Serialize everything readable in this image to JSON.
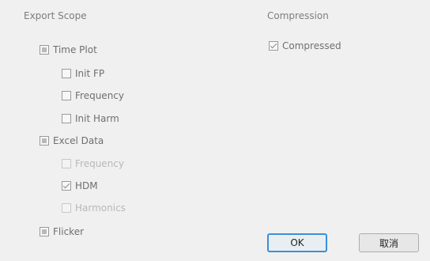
{
  "export_scope": {
    "title": "Export Scope",
    "items": [
      {
        "label": "Time Plot",
        "state": "indeterminate",
        "disabled": false
      },
      {
        "label": "Init FP",
        "state": "unchecked",
        "disabled": false
      },
      {
        "label": "Frequency",
        "state": "unchecked",
        "disabled": false
      },
      {
        "label": "Init Harm",
        "state": "unchecked",
        "disabled": false
      },
      {
        "label": "Excel Data",
        "state": "indeterminate",
        "disabled": false
      },
      {
        "label": "Frequency",
        "state": "unchecked",
        "disabled": true
      },
      {
        "label": "HDM",
        "state": "checked",
        "disabled": false
      },
      {
        "label": "Harmonics",
        "state": "unchecked",
        "disabled": true
      },
      {
        "label": "Flicker",
        "state": "indeterminate",
        "disabled": false
      }
    ]
  },
  "compression": {
    "title": "Compression",
    "items": [
      {
        "label": "Compressed",
        "state": "checked",
        "disabled": false
      }
    ]
  },
  "buttons": {
    "ok": "OK",
    "cancel": "取消"
  }
}
